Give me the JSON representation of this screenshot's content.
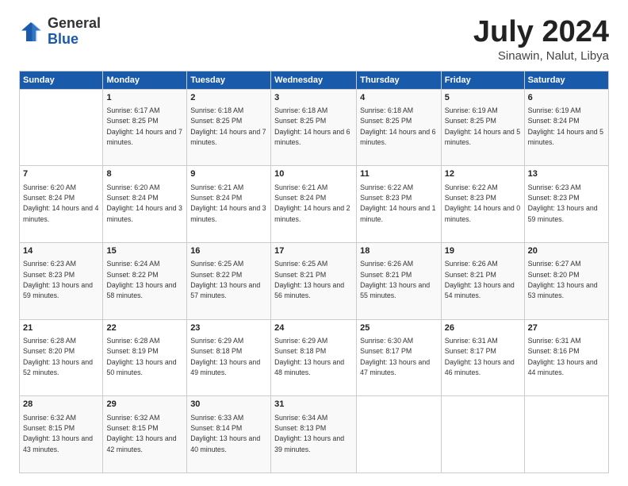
{
  "header": {
    "logo_general": "General",
    "logo_blue": "Blue",
    "title": "July 2024",
    "subtitle": "Sinawin, Nalut, Libya"
  },
  "days_header": [
    "Sunday",
    "Monday",
    "Tuesday",
    "Wednesday",
    "Thursday",
    "Friday",
    "Saturday"
  ],
  "weeks": [
    [
      {
        "day": "",
        "sunrise": "",
        "sunset": "",
        "daylight": ""
      },
      {
        "day": "1",
        "sunrise": "Sunrise: 6:17 AM",
        "sunset": "Sunset: 8:25 PM",
        "daylight": "Daylight: 14 hours and 7 minutes."
      },
      {
        "day": "2",
        "sunrise": "Sunrise: 6:18 AM",
        "sunset": "Sunset: 8:25 PM",
        "daylight": "Daylight: 14 hours and 7 minutes."
      },
      {
        "day": "3",
        "sunrise": "Sunrise: 6:18 AM",
        "sunset": "Sunset: 8:25 PM",
        "daylight": "Daylight: 14 hours and 6 minutes."
      },
      {
        "day": "4",
        "sunrise": "Sunrise: 6:18 AM",
        "sunset": "Sunset: 8:25 PM",
        "daylight": "Daylight: 14 hours and 6 minutes."
      },
      {
        "day": "5",
        "sunrise": "Sunrise: 6:19 AM",
        "sunset": "Sunset: 8:25 PM",
        "daylight": "Daylight: 14 hours and 5 minutes."
      },
      {
        "day": "6",
        "sunrise": "Sunrise: 6:19 AM",
        "sunset": "Sunset: 8:24 PM",
        "daylight": "Daylight: 14 hours and 5 minutes."
      }
    ],
    [
      {
        "day": "7",
        "sunrise": "Sunrise: 6:20 AM",
        "sunset": "Sunset: 8:24 PM",
        "daylight": "Daylight: 14 hours and 4 minutes."
      },
      {
        "day": "8",
        "sunrise": "Sunrise: 6:20 AM",
        "sunset": "Sunset: 8:24 PM",
        "daylight": "Daylight: 14 hours and 3 minutes."
      },
      {
        "day": "9",
        "sunrise": "Sunrise: 6:21 AM",
        "sunset": "Sunset: 8:24 PM",
        "daylight": "Daylight: 14 hours and 3 minutes."
      },
      {
        "day": "10",
        "sunrise": "Sunrise: 6:21 AM",
        "sunset": "Sunset: 8:24 PM",
        "daylight": "Daylight: 14 hours and 2 minutes."
      },
      {
        "day": "11",
        "sunrise": "Sunrise: 6:22 AM",
        "sunset": "Sunset: 8:23 PM",
        "daylight": "Daylight: 14 hours and 1 minute."
      },
      {
        "day": "12",
        "sunrise": "Sunrise: 6:22 AM",
        "sunset": "Sunset: 8:23 PM",
        "daylight": "Daylight: 14 hours and 0 minutes."
      },
      {
        "day": "13",
        "sunrise": "Sunrise: 6:23 AM",
        "sunset": "Sunset: 8:23 PM",
        "daylight": "Daylight: 13 hours and 59 minutes."
      }
    ],
    [
      {
        "day": "14",
        "sunrise": "Sunrise: 6:23 AM",
        "sunset": "Sunset: 8:23 PM",
        "daylight": "Daylight: 13 hours and 59 minutes."
      },
      {
        "day": "15",
        "sunrise": "Sunrise: 6:24 AM",
        "sunset": "Sunset: 8:22 PM",
        "daylight": "Daylight: 13 hours and 58 minutes."
      },
      {
        "day": "16",
        "sunrise": "Sunrise: 6:25 AM",
        "sunset": "Sunset: 8:22 PM",
        "daylight": "Daylight: 13 hours and 57 minutes."
      },
      {
        "day": "17",
        "sunrise": "Sunrise: 6:25 AM",
        "sunset": "Sunset: 8:21 PM",
        "daylight": "Daylight: 13 hours and 56 minutes."
      },
      {
        "day": "18",
        "sunrise": "Sunrise: 6:26 AM",
        "sunset": "Sunset: 8:21 PM",
        "daylight": "Daylight: 13 hours and 55 minutes."
      },
      {
        "day": "19",
        "sunrise": "Sunrise: 6:26 AM",
        "sunset": "Sunset: 8:21 PM",
        "daylight": "Daylight: 13 hours and 54 minutes."
      },
      {
        "day": "20",
        "sunrise": "Sunrise: 6:27 AM",
        "sunset": "Sunset: 8:20 PM",
        "daylight": "Daylight: 13 hours and 53 minutes."
      }
    ],
    [
      {
        "day": "21",
        "sunrise": "Sunrise: 6:28 AM",
        "sunset": "Sunset: 8:20 PM",
        "daylight": "Daylight: 13 hours and 52 minutes."
      },
      {
        "day": "22",
        "sunrise": "Sunrise: 6:28 AM",
        "sunset": "Sunset: 8:19 PM",
        "daylight": "Daylight: 13 hours and 50 minutes."
      },
      {
        "day": "23",
        "sunrise": "Sunrise: 6:29 AM",
        "sunset": "Sunset: 8:18 PM",
        "daylight": "Daylight: 13 hours and 49 minutes."
      },
      {
        "day": "24",
        "sunrise": "Sunrise: 6:29 AM",
        "sunset": "Sunset: 8:18 PM",
        "daylight": "Daylight: 13 hours and 48 minutes."
      },
      {
        "day": "25",
        "sunrise": "Sunrise: 6:30 AM",
        "sunset": "Sunset: 8:17 PM",
        "daylight": "Daylight: 13 hours and 47 minutes."
      },
      {
        "day": "26",
        "sunrise": "Sunrise: 6:31 AM",
        "sunset": "Sunset: 8:17 PM",
        "daylight": "Daylight: 13 hours and 46 minutes."
      },
      {
        "day": "27",
        "sunrise": "Sunrise: 6:31 AM",
        "sunset": "Sunset: 8:16 PM",
        "daylight": "Daylight: 13 hours and 44 minutes."
      }
    ],
    [
      {
        "day": "28",
        "sunrise": "Sunrise: 6:32 AM",
        "sunset": "Sunset: 8:15 PM",
        "daylight": "Daylight: 13 hours and 43 minutes."
      },
      {
        "day": "29",
        "sunrise": "Sunrise: 6:32 AM",
        "sunset": "Sunset: 8:15 PM",
        "daylight": "Daylight: 13 hours and 42 minutes."
      },
      {
        "day": "30",
        "sunrise": "Sunrise: 6:33 AM",
        "sunset": "Sunset: 8:14 PM",
        "daylight": "Daylight: 13 hours and 40 minutes."
      },
      {
        "day": "31",
        "sunrise": "Sunrise: 6:34 AM",
        "sunset": "Sunset: 8:13 PM",
        "daylight": "Daylight: 13 hours and 39 minutes."
      },
      {
        "day": "",
        "sunrise": "",
        "sunset": "",
        "daylight": ""
      },
      {
        "day": "",
        "sunrise": "",
        "sunset": "",
        "daylight": ""
      },
      {
        "day": "",
        "sunrise": "",
        "sunset": "",
        "daylight": ""
      }
    ]
  ]
}
